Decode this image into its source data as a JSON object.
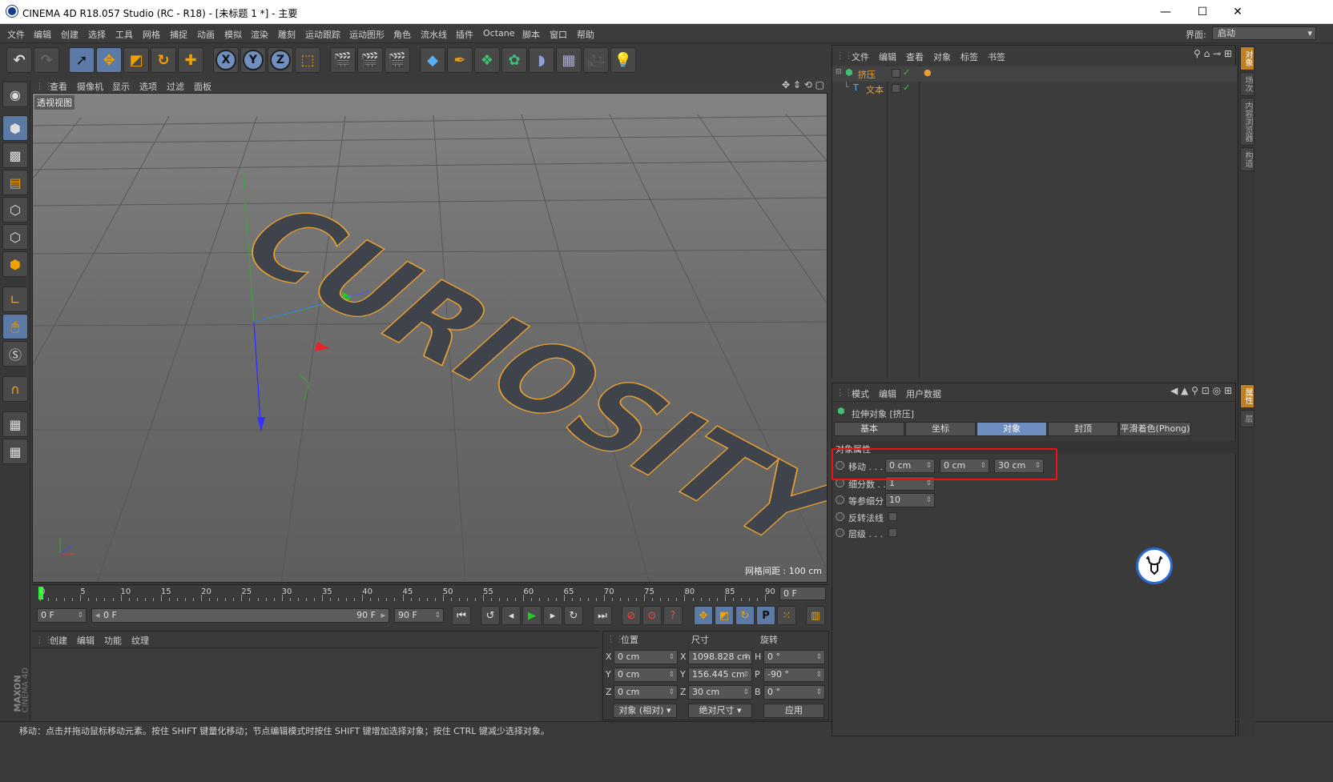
{
  "window": {
    "title": "CINEMA 4D R18.057 Studio (RC - R18) - [未标题 1 *] - 主要",
    "min": "—",
    "max": "☐",
    "close": "✕"
  },
  "menu": [
    "文件",
    "编辑",
    "创建",
    "选择",
    "工具",
    "网格",
    "捕捉",
    "动画",
    "模拟",
    "渲染",
    "雕刻",
    "运动跟踪",
    "运动图形",
    "角色",
    "流水线",
    "插件",
    "Octane",
    "脚本",
    "窗口",
    "帮助"
  ],
  "layout": {
    "label": "界面:",
    "value": "启动"
  },
  "viewport": {
    "menu": [
      "查看",
      "摄像机",
      "显示",
      "选项",
      "过滤",
      "面板"
    ],
    "label": "透视视图",
    "grid": "网格间距 : 100 cm",
    "text3d": "CURIOSITY"
  },
  "timeline": {
    "ticks": [
      "0",
      "5",
      "10",
      "15",
      "20",
      "25",
      "30",
      "35",
      "40",
      "45",
      "50",
      "55",
      "60",
      "65",
      "70",
      "75",
      "80",
      "85",
      "90"
    ],
    "end_field": "0 F"
  },
  "transport": {
    "start": "0 F",
    "range_start": "0 F",
    "range_end": "90 F",
    "end": "90 F"
  },
  "material": {
    "menu": [
      "创建",
      "编辑",
      "功能",
      "纹理"
    ]
  },
  "coords": {
    "headers": [
      "位置",
      "尺寸",
      "旋转"
    ],
    "rows": [
      {
        "a": "X",
        "pos": "0 cm",
        "b": "X",
        "size": "1098.828 cm",
        "c": "H",
        "rot": "0 °"
      },
      {
        "a": "Y",
        "pos": "0 cm",
        "b": "Y",
        "size": "156.445 cm",
        "c": "P",
        "rot": "-90 °"
      },
      {
        "a": "Z",
        "pos": "0 cm",
        "b": "Z",
        "size": "30 cm",
        "c": "B",
        "rot": "0 °"
      }
    ],
    "mode": "对象 (相对)",
    "size_mode": "绝对尺寸",
    "apply": "应用"
  },
  "status": "移动：点击并拖动鼠标移动元素。按住 SHIFT 键量化移动；节点编辑模式时按住 SHIFT 键增加选择对象；按住 CTRL 键减少选择对象。",
  "brand": {
    "maxon": "MAXON",
    "product": "CINEMA 4D"
  },
  "objects": {
    "menu": [
      "文件",
      "编辑",
      "查看",
      "对象",
      "标签",
      "书签"
    ],
    "items": [
      {
        "name": "挤压",
        "indent": 0
      },
      {
        "name": "文本",
        "indent": 1
      }
    ]
  },
  "attributes": {
    "menu": [
      "模式",
      "编辑",
      "用户数据"
    ],
    "title": "拉伸对象 [挤压]",
    "tabs": [
      "基本",
      "坐标",
      "对象",
      "封顶",
      "平滑着色(Phong)"
    ],
    "active_tab": 2,
    "section": "对象属性",
    "move_label": "移动 . . .",
    "move": [
      "0 cm",
      "0 cm",
      "30 cm"
    ],
    "subdiv_label": "细分数 . .",
    "subdiv": "1",
    "iso_label": "等参细分",
    "iso": "10",
    "flip_label": "反转法线",
    "hier_label": "层级 . . ."
  },
  "right_tabs": [
    "对象",
    "场次",
    "内容浏览器",
    "构造",
    "属性",
    "层"
  ],
  "colors": {
    "accent": "#6e8ec0",
    "highlight": "#e11111",
    "object": "#e8a030"
  }
}
